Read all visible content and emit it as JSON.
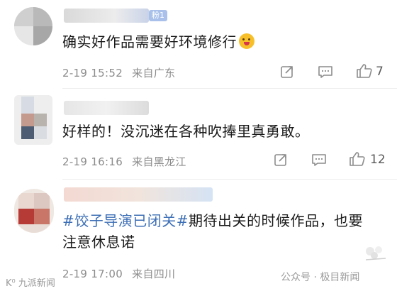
{
  "comments": [
    {
      "badge": "粉1",
      "text": "确实好作品需要好环境修行",
      "emoji": "smiling-face-tongue",
      "date": "2-19",
      "time": "15:52",
      "location": "来自广东",
      "likes": "7"
    },
    {
      "text": "好样的！没沉迷在各种吹捧里真勇敢。",
      "date": "2-19",
      "time": "16:16",
      "location": "来自黑龙江",
      "likes": "12"
    },
    {
      "topic": "#饺子导演已闭关#",
      "text_after": "期待出关的时候作品，也要",
      "text_line2": "注意休息诺",
      "date": "2-19",
      "time": "17:00",
      "location": "来自四川"
    }
  ],
  "watermarks": {
    "left": "K⁰ 九派新闻",
    "right": "公众号 · 极目新闻"
  },
  "colors": {
    "topic": "#3d6fb6",
    "meta": "#8c8c8c",
    "text": "#1a1a1a"
  }
}
